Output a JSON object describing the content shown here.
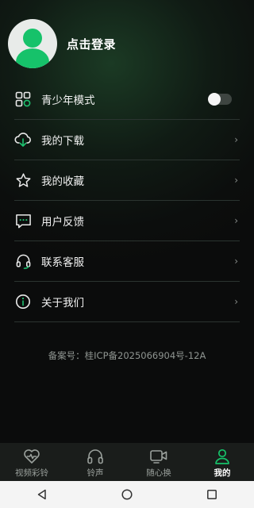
{
  "profile": {
    "login_label": "点击登录"
  },
  "menu": [
    {
      "id": "teen-mode",
      "label": "青少年模式",
      "icon": "grid-apps-icon",
      "control": "toggle",
      "toggle_on": false
    },
    {
      "id": "downloads",
      "label": "我的下载",
      "icon": "cloud-download-icon"
    },
    {
      "id": "favorites",
      "label": "我的收藏",
      "icon": "star-icon"
    },
    {
      "id": "feedback",
      "label": "用户反馈",
      "icon": "message-icon"
    },
    {
      "id": "support",
      "label": "联系客服",
      "icon": "headset-icon"
    },
    {
      "id": "about",
      "label": "关于我们",
      "icon": "info-icon"
    }
  ],
  "chevron": "›",
  "record_text": "备案号：桂ICP备2025066904号-12A",
  "tabs": [
    {
      "label": "视频彩铃",
      "icon": "heart-video-icon",
      "active": false
    },
    {
      "label": "铃声",
      "icon": "headphones-icon",
      "active": false
    },
    {
      "label": "随心换",
      "icon": "video-camera-icon",
      "active": false
    },
    {
      "label": "我的",
      "icon": "person-icon",
      "active": true
    }
  ],
  "colors": {
    "accent": "#16c26a",
    "icon_green": "#1ec16f"
  }
}
